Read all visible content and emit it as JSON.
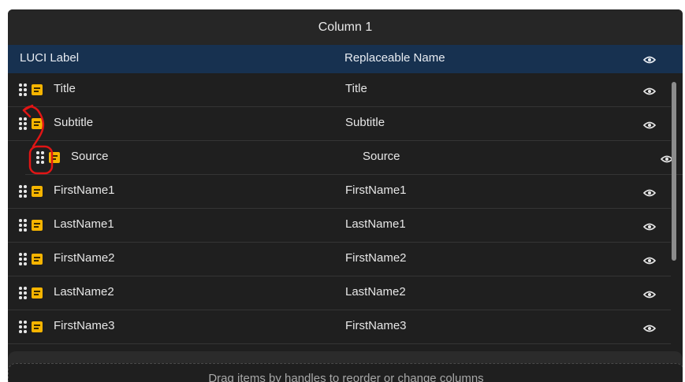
{
  "column": {
    "title": "Column 1"
  },
  "table": {
    "headers": {
      "label": "LUCI Label",
      "name": "Replaceable Name"
    },
    "rows": [
      {
        "label": "Title",
        "name": "Title"
      },
      {
        "label": "Subtitle",
        "name": "Subtitle"
      },
      {
        "label": "Source",
        "name": "Source"
      },
      {
        "label": "FirstName1",
        "name": "FirstName1"
      },
      {
        "label": "LastName1",
        "name": "LastName1"
      },
      {
        "label": "FirstName2",
        "name": "FirstName2"
      },
      {
        "label": "LastName2",
        "name": "LastName2"
      },
      {
        "label": "FirstName3",
        "name": "FirstName3"
      }
    ]
  },
  "footer": {
    "hint": "Drag items by handles to reorder or change columns"
  },
  "icons": {
    "handle": "drag-handle-icon",
    "note": "note-icon",
    "visibility": "eye-icon"
  },
  "colors": {
    "background": "#1f1f1f",
    "header": "#173150",
    "note": "#f5b400",
    "annotation": "#e01515"
  }
}
